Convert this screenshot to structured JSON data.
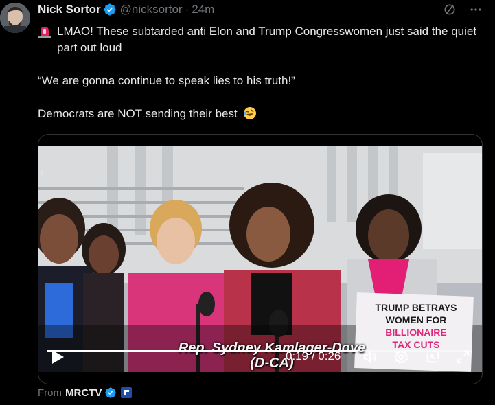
{
  "post": {
    "author_name": "Nick Sortor",
    "handle": "@nicksortor",
    "separator": "·",
    "time": "24m",
    "line1": "LMAO! These subtarded anti Elon and Trump Congresswomen just said the quiet part out loud",
    "line2": "“We are gonna continue to speak lies to his truth!”",
    "line3": "Democrats are NOT sending their best"
  },
  "video": {
    "caption_name": "Rep. Sydney Kamlager-Dove",
    "caption_party": "(D-CA)",
    "sign_line1": "TRUMP BETRAYS",
    "sign_line2": "WOMEN FOR",
    "sign_line3": "BILLIONAIRE",
    "sign_line4": "TAX CUTS",
    "time_current": "0:19",
    "time_sep": "/",
    "time_total": "0:26",
    "progress": 0.73
  },
  "source": {
    "prefix": "From",
    "name": "MRCTV"
  },
  "colors": {
    "background": "#000000",
    "text": "#e7e9ea",
    "muted": "#71767b",
    "verified_blue": "#1d9bf0",
    "border": "#2f3336"
  },
  "icons": [
    "verified-badge-icon",
    "grok-icon",
    "more-icon",
    "siren-emoji-icon",
    "rofl-emoji-icon",
    "play-icon",
    "volume-icon",
    "settings-icon",
    "picture-in-picture-icon",
    "fullscreen-icon"
  ]
}
